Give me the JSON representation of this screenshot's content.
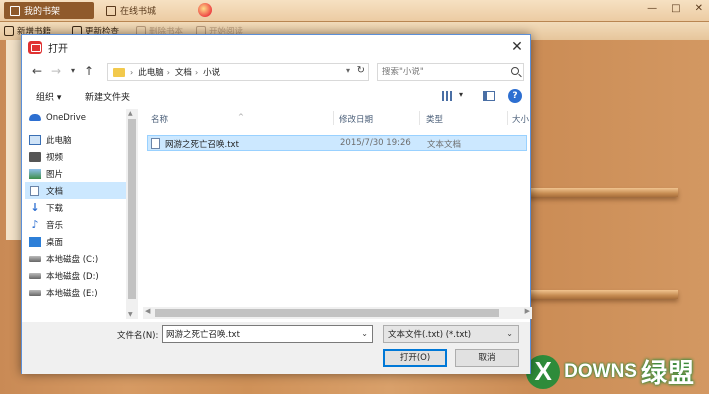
{
  "app": {
    "tabs": [
      "我的书架",
      "在线书城"
    ],
    "toolbar": [
      "新增书籍",
      "更新检查",
      "删除书本",
      "开始阅读"
    ],
    "window_controls": [
      "—",
      "□",
      "✕"
    ]
  },
  "dialog": {
    "title": "打开",
    "breadcrumb": [
      "此电脑",
      "文档",
      "小说"
    ],
    "search_placeholder": "搜索\"小说\"",
    "commands": {
      "organize": "组织 ▾",
      "new_folder": "新建文件夹",
      "help": "?"
    },
    "nav_items": [
      {
        "label": "OneDrive",
        "icon": "onedrive-icon"
      },
      {
        "label": "此电脑",
        "icon": "computer-icon"
      },
      {
        "label": "视频",
        "icon": "video-icon"
      },
      {
        "label": "图片",
        "icon": "picture-icon"
      },
      {
        "label": "文档",
        "icon": "document-icon",
        "selected": true
      },
      {
        "label": "下载",
        "icon": "download-icon"
      },
      {
        "label": "音乐",
        "icon": "music-icon"
      },
      {
        "label": "桌面",
        "icon": "desktop-icon"
      },
      {
        "label": "本地磁盘 (C:)",
        "icon": "drive-icon"
      },
      {
        "label": "本地磁盘 (D:)",
        "icon": "drive-icon"
      },
      {
        "label": "本地磁盘 (E:)",
        "icon": "drive-icon"
      }
    ],
    "columns": {
      "name": "名称",
      "modified": "修改日期",
      "type": "类型",
      "size": "大小"
    },
    "files": [
      {
        "name": "网游之死亡召唤.txt",
        "modified": "2015/7/30 19:26",
        "type": "文本文档"
      }
    ],
    "filename_label": "文件名(N):",
    "filename_value": "网游之死亡召唤.txt",
    "filetype_value": "文本文件(.txt) (*.txt)",
    "open_button": "打开(O)",
    "cancel_button": "取消"
  },
  "watermark": {
    "mark": "X",
    "text": "DOWNS",
    "cn": "绿盟"
  },
  "colors": {
    "accent": "#0078d7",
    "selection": "#cce8ff",
    "wood": "#d39862"
  }
}
